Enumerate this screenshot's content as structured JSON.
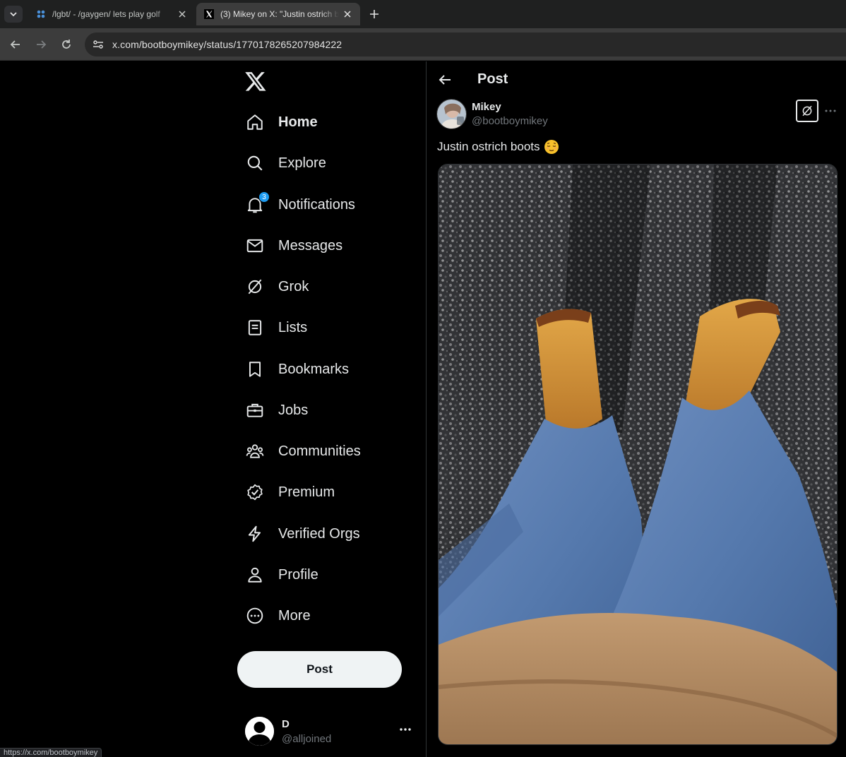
{
  "browser": {
    "tabs": [
      {
        "title": "/lgbt/ - /gaygen/ lets play golf",
        "active": false
      },
      {
        "title": "(3) Mikey on X: \"Justin ostrich boots\"",
        "active": true
      }
    ],
    "url": "x.com/bootboymikey/status/1770178265207984222",
    "status_url": "https://x.com/bootboymikey"
  },
  "sidebar": {
    "items": [
      {
        "label": "Home",
        "icon": "home-icon"
      },
      {
        "label": "Explore",
        "icon": "search-icon"
      },
      {
        "label": "Notifications",
        "icon": "bell-icon",
        "badge": "3"
      },
      {
        "label": "Messages",
        "icon": "envelope-icon"
      },
      {
        "label": "Grok",
        "icon": "grok-icon"
      },
      {
        "label": "Lists",
        "icon": "list-icon"
      },
      {
        "label": "Bookmarks",
        "icon": "bookmark-icon"
      },
      {
        "label": "Jobs",
        "icon": "briefcase-icon"
      },
      {
        "label": "Communities",
        "icon": "people-icon"
      },
      {
        "label": "Premium",
        "icon": "verified-badge-icon"
      },
      {
        "label": "Verified Orgs",
        "icon": "lightning-icon"
      },
      {
        "label": "Profile",
        "icon": "person-icon"
      },
      {
        "label": "More",
        "icon": "more-circle-icon"
      }
    ],
    "post_button": "Post",
    "account": {
      "name": "D",
      "handle": "@alljoined"
    }
  },
  "main": {
    "header_title": "Post",
    "author": {
      "name": "Mikey",
      "handle": "@bootboymikey"
    },
    "post_text": "Justin ostrich boots",
    "post_emoji": "relieved-face-emoji"
  },
  "colors": {
    "accent": "#1d9bf0",
    "text": "#e7e9ea",
    "muted": "#71767b",
    "border": "#2f3336"
  }
}
